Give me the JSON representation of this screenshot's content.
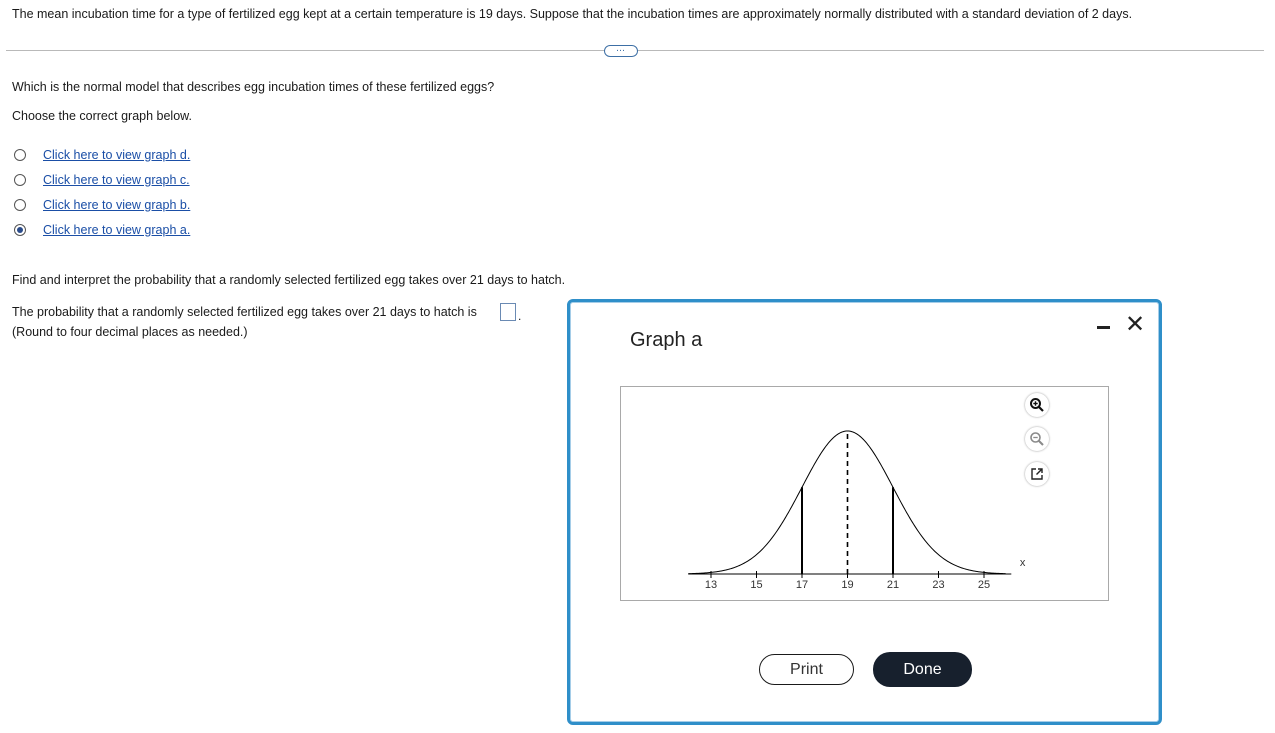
{
  "problem_text": "The mean incubation time for a type of fertilized egg kept at a certain temperature is 19 days. Suppose that the incubation times are approximately normally distributed with a standard deviation of 2 days.",
  "expand_glyph": "…",
  "question": "Which is the normal model that describes egg incubation times of these fertilized eggs?",
  "choose": "Choose the correct graph below.",
  "options": [
    {
      "label": "Click here to view graph d.",
      "selected": false
    },
    {
      "label": "Click here to view graph c.",
      "selected": false
    },
    {
      "label": "Click here to view graph b.",
      "selected": false
    },
    {
      "label": "Click here to view graph a.",
      "selected": true
    }
  ],
  "find_text": "Find and interpret the probability that a randomly selected fertilized egg takes over 21 days to hatch.",
  "prob_text": "The probability that a randomly selected fertilized egg takes over 21 days to hatch is",
  "answer_value": "",
  "answer_suffix": ".",
  "round_note": "(Round to four decimal places as needed.)",
  "dialog": {
    "title": "Graph a",
    "close_glyph": "✕",
    "print_label": "Print",
    "done_label": "Done",
    "tools": [
      "zoom-in-icon",
      "zoom-out-icon",
      "pop-out-icon"
    ]
  },
  "chart_data": {
    "type": "line",
    "mean": 19,
    "sd": 2,
    "x_ticks": [
      13,
      15,
      17,
      19,
      21,
      23,
      25
    ],
    "xlabel": "x",
    "xlim": [
      11,
      27
    ],
    "solid_lines_at": [
      17,
      21
    ],
    "dashed_line_at": 19,
    "curve_color": "#000000"
  }
}
